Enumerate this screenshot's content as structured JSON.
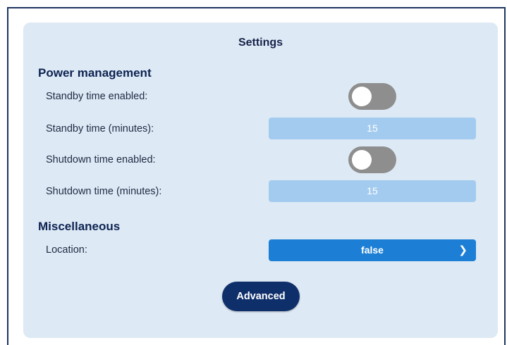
{
  "panel": {
    "title": "Settings"
  },
  "power_management": {
    "heading": "Power management",
    "standby_enabled": {
      "label": "Standby time enabled:",
      "value": false
    },
    "standby_minutes": {
      "label": "Standby time (minutes):",
      "value": "15"
    },
    "shutdown_enabled": {
      "label": "Shutdown time enabled:",
      "value": false
    },
    "shutdown_minutes": {
      "label": "Shutdown time (minutes):",
      "value": "15"
    }
  },
  "miscellaneous": {
    "heading": "Miscellaneous",
    "location": {
      "label": "Location:",
      "value": "false",
      "chevron_icon": "chevron-right-icon"
    }
  },
  "actions": {
    "advanced_label": "Advanced"
  },
  "colors": {
    "panel_bg": "#dde9f4",
    "toggle_off": "#8e8e8e",
    "field_bg": "#a3cbef",
    "select_bg": "#1c7fd5",
    "primary_button": "#0f2f6b",
    "heading_text": "#0d2352"
  }
}
